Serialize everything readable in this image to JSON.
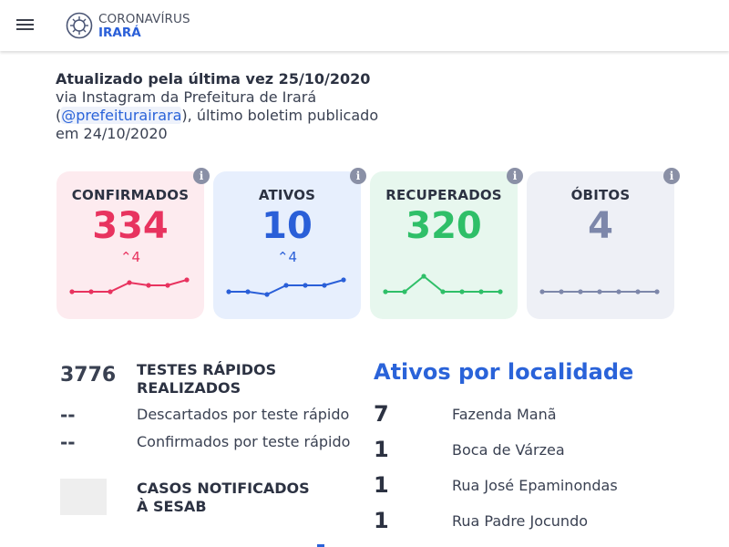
{
  "header": {
    "logo_line1": "CORONAVÍRUS",
    "logo_line2": "IRARÁ",
    "menu_icon": "hamburger-menu-icon",
    "logo_icon": "virus-logo-icon"
  },
  "update": {
    "title": "Atualizado pela última vez 25/10/2020",
    "line_prefix": "via Instagram da Prefeitura de Irará (",
    "handle": "@prefeiturairara",
    "line_suffix": "), último boletim publicado em 24/10/2020"
  },
  "colors": {
    "confirmados": "#e8335f",
    "ativos": "#2a5fd8",
    "recuperados": "#2fbf68",
    "obitos": "#7d87aa",
    "accent": "#2a63d9"
  },
  "cards": [
    {
      "label": "CONFIRMADOS",
      "value": "334",
      "delta": "4",
      "trend": [
        1,
        1,
        1,
        2,
        1.7,
        1.7,
        2.3
      ],
      "info_icon": "info-icon"
    },
    {
      "label": "ATIVOS",
      "value": "10",
      "delta": "4",
      "trend": [
        1,
        1,
        0.7,
        1.7,
        1.7,
        1.7,
        2.3
      ],
      "info_icon": "info-icon"
    },
    {
      "label": "RECUPERADOS",
      "value": "320",
      "delta": "",
      "trend": [
        1,
        1,
        2.7,
        1,
        1,
        1,
        1
      ],
      "info_icon": "info-icon"
    },
    {
      "label": "ÓBITOS",
      "value": "4",
      "delta": "",
      "trend": [
        1,
        1,
        1,
        1,
        1,
        1,
        1
      ],
      "info_icon": "info-icon"
    }
  ],
  "tests": {
    "rapid_total": "3776",
    "rapid_label": "TESTES RÁPIDOS REALIZADOS",
    "discarded_value": "--",
    "discarded_label": "Descartados por teste rápido",
    "confirmed_value": "--",
    "confirmed_label": "Confirmados por teste rápido",
    "notified_label": "CASOS NOTIFICADOS À SESAB"
  },
  "localidades": {
    "title": "Ativos por localidade",
    "items": [
      {
        "count": "7",
        "name": "Fazenda Manã"
      },
      {
        "count": "1",
        "name": "Boca de Várzea"
      },
      {
        "count": "1",
        "name": "Rua José Epaminondas"
      },
      {
        "count": "1",
        "name": "Rua Padre Jocundo"
      }
    ]
  }
}
